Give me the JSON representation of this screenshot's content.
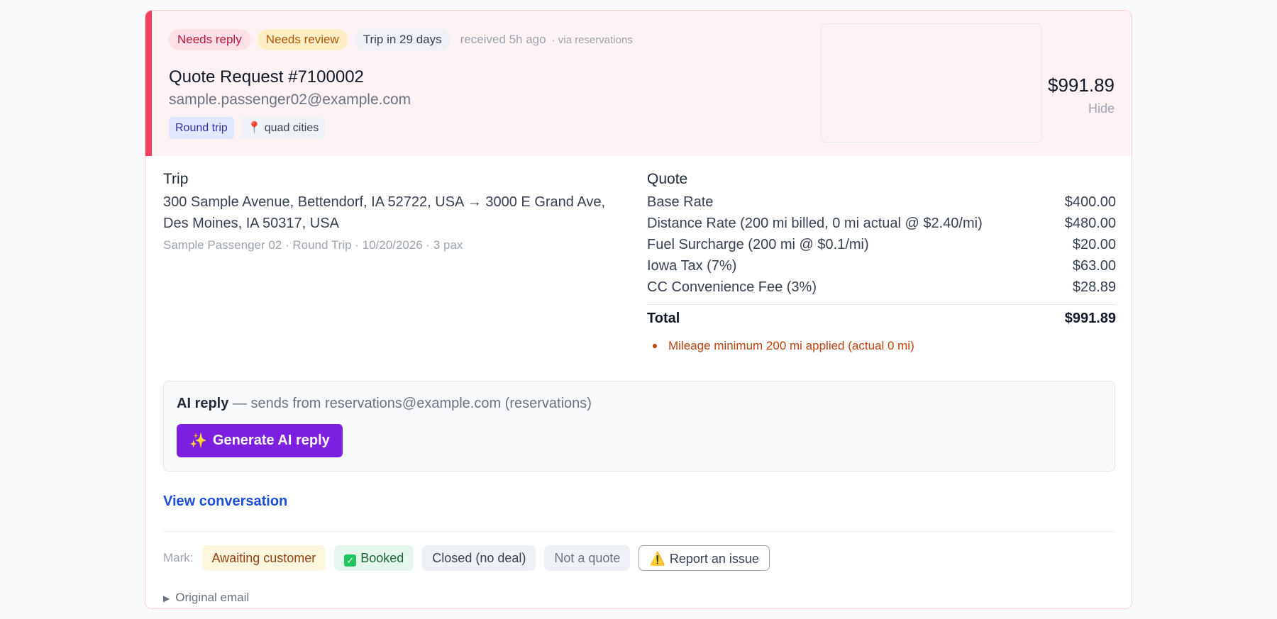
{
  "header": {
    "badges": {
      "reply": "Needs reply",
      "review": "Needs review",
      "trip": "Trip in 29 days"
    },
    "received": "received 5h ago",
    "via": "· via reservations",
    "title": "Quote Request #7100002",
    "email": "sample.passenger02@example.com",
    "tags": {
      "round": "Round trip",
      "location": "quad cities"
    },
    "price": "$991.89",
    "hide": "Hide"
  },
  "trip": {
    "title": "Trip",
    "route": "300 Sample Avenue, Bettendorf, IA 52722, USA → 3000 E Grand Ave, Des Moines, IA 50317, USA",
    "meta": "Sample Passenger 02 · Round Trip · 10/20/2026 · 3 pax"
  },
  "quote": {
    "title": "Quote",
    "lines": [
      {
        "label": "Base Rate",
        "amount": "$400.00"
      },
      {
        "label": "Distance Rate (200 mi billed, 0 mi actual @ $2.40/mi)",
        "amount": "$480.00"
      },
      {
        "label": "Fuel Surcharge (200 mi @ $0.1/mi)",
        "amount": "$20.00"
      },
      {
        "label": "Iowa Tax (7%)",
        "amount": "$63.00"
      },
      {
        "label": "CC Convenience Fee (3%)",
        "amount": "$28.89"
      }
    ],
    "total_label": "Total",
    "total_amount": "$991.89",
    "note": "Mileage minimum 200 mi applied (actual 0 mi)"
  },
  "ai": {
    "title": "AI reply",
    "sender": " — sends from reservations@example.com (reservations)",
    "button": "Generate AI reply"
  },
  "links": {
    "view_conversation": "View conversation"
  },
  "mark": {
    "label": "Mark:",
    "awaiting": "Awaiting customer",
    "booked": "Booked",
    "closed": "Closed (no deal)",
    "not_quote": "Not a quote",
    "report": "Report an issue"
  },
  "original_email": "Original email",
  "colors": {
    "accent_bar": "#f43f5e",
    "header_bg": "#fdf2f4",
    "primary_button": "#7c1fe0",
    "link": "#1d4ed8"
  },
  "icons": {
    "location": "pin-icon",
    "generate": "sparkles-icon",
    "booked": "check-box-icon",
    "report": "warning-icon",
    "expand": "triangle-right-icon"
  }
}
